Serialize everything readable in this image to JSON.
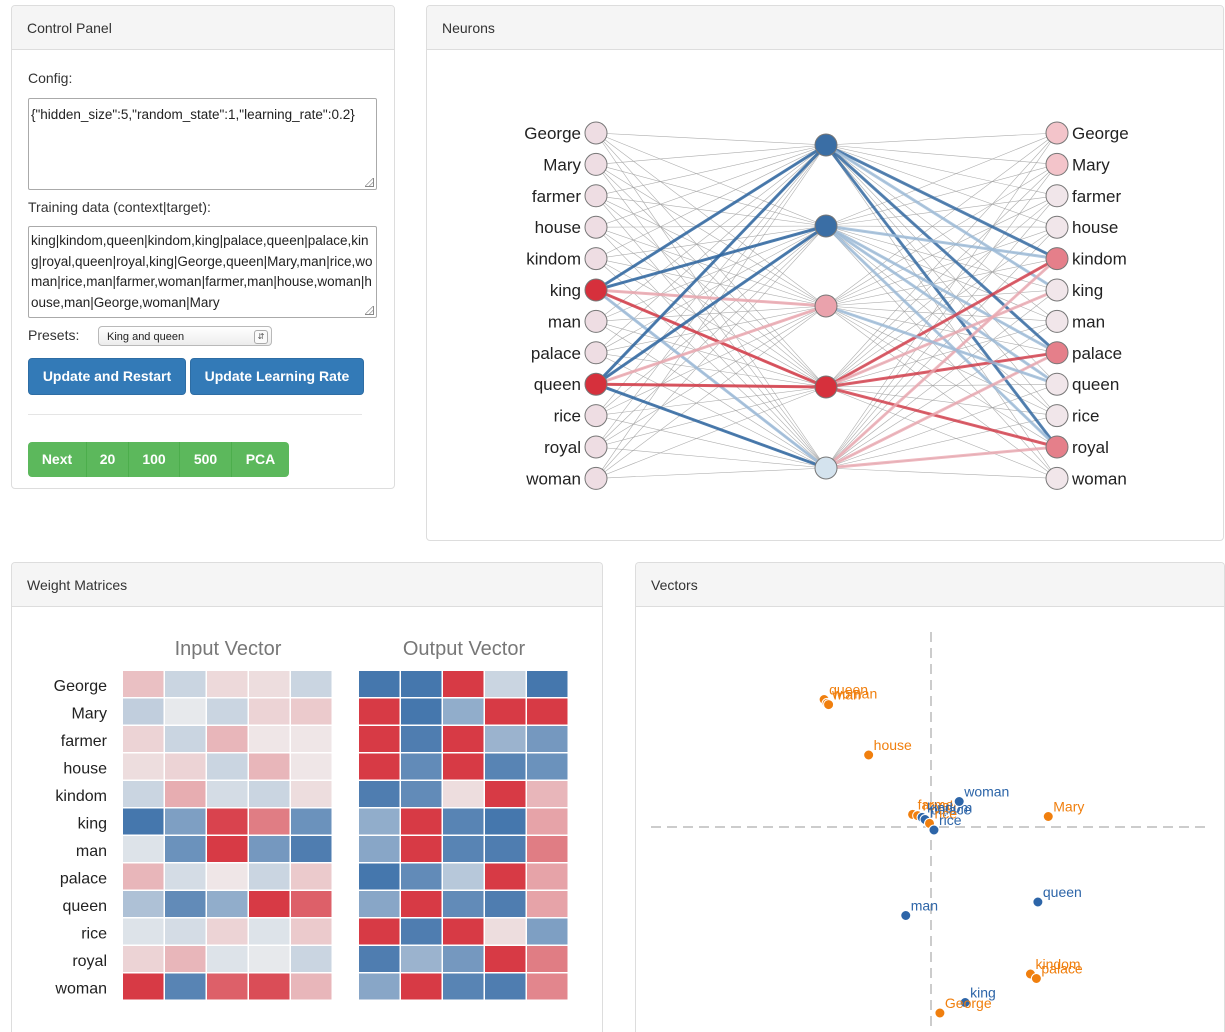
{
  "control_panel": {
    "title": "Control Panel",
    "config_label": "Config:",
    "config_value": "{\"hidden_size\":5,\"random_state\":1,\"learning_rate\":0.2}",
    "training_label": "Training data (context|target):",
    "training_value": "king|kindom,queen|kindom,king|palace,queen|palace,king|royal,queen|royal,king|George,queen|Mary,man|rice,woman|rice,man|farmer,woman|farmer,man|house,woman|house,man|George,woman|Mary",
    "presets_label": "Presets:",
    "preset_selected": "King and queen",
    "update_restart_label": "Update and Restart",
    "update_lr_label": "Update Learning Rate",
    "step_buttons": [
      "Next",
      "20",
      "100",
      "500",
      "PCA"
    ]
  },
  "neurons": {
    "title": "Neurons",
    "words": [
      "George",
      "Mary",
      "farmer",
      "house",
      "kindom",
      "king",
      "man",
      "palace",
      "queen",
      "rice",
      "royal",
      "woman"
    ],
    "input_colors": [
      "#eedde3",
      "#eedde3",
      "#eedde3",
      "#eedde3",
      "#eedde3",
      "#d6303c",
      "#eedde3",
      "#eedde3",
      "#d6303c",
      "#eedde3",
      "#eedde3",
      "#eedde3"
    ],
    "hidden_colors": [
      "#3a6ea5",
      "#3a6ea5",
      "#eaa2ac",
      "#d6303c",
      "#d4e3ee"
    ],
    "output_colors": [
      "#f3c4ca",
      "#f3c4ca",
      "#f1e6ea",
      "#f1e6ea",
      "#e57f8a",
      "#f1e6ea",
      "#f1e6ea",
      "#e57f8a",
      "#f1e6ea",
      "#f1e6ea",
      "#e57f8a",
      "#f1e6ea"
    ]
  },
  "weights": {
    "title": "Weight Matrices",
    "input_title": "Input Vector",
    "output_title": "Output Vector",
    "rows": [
      "George",
      "Mary",
      "farmer",
      "house",
      "kindom",
      "king",
      "man",
      "palace",
      "queen",
      "rice",
      "royal",
      "woman"
    ],
    "input_matrix": [
      [
        0.25,
        -0.2,
        0.12,
        0.1,
        -0.2
      ],
      [
        -0.25,
        -0.05,
        -0.2,
        0.15,
        0.2
      ],
      [
        0.15,
        -0.2,
        0.3,
        0.05,
        0.05
      ],
      [
        0.1,
        0.15,
        -0.2,
        0.3,
        0.05
      ],
      [
        -0.2,
        0.35,
        -0.15,
        -0.2,
        0.1
      ],
      [
        -0.9,
        -0.6,
        0.9,
        0.6,
        -0.7
      ],
      [
        -0.1,
        -0.7,
        0.95,
        -0.65,
        -0.85
      ],
      [
        0.3,
        -0.15,
        0.05,
        -0.2,
        0.2
      ],
      [
        -0.35,
        -0.75,
        -0.5,
        0.95,
        0.75
      ],
      [
        -0.1,
        -0.15,
        0.15,
        -0.1,
        0.2
      ],
      [
        0.15,
        0.3,
        -0.1,
        -0.05,
        -0.2
      ],
      [
        0.95,
        -0.8,
        0.75,
        0.85,
        0.3
      ]
    ],
    "output_matrix": [
      [
        -0.9,
        -0.9,
        0.95,
        -0.2,
        -0.9
      ],
      [
        0.95,
        -0.9,
        -0.5,
        0.95,
        0.95
      ],
      [
        0.95,
        -0.85,
        0.95,
        -0.45,
        -0.65
      ],
      [
        0.95,
        -0.75,
        0.95,
        -0.8,
        -0.7
      ],
      [
        -0.85,
        -0.75,
        0.1,
        0.95,
        0.3
      ],
      [
        -0.5,
        0.95,
        -0.8,
        -0.9,
        0.4
      ],
      [
        -0.55,
        0.95,
        -0.8,
        -0.85,
        0.6
      ],
      [
        -0.9,
        -0.75,
        -0.3,
        0.95,
        0.4
      ],
      [
        -0.55,
        0.95,
        -0.75,
        -0.85,
        0.4
      ],
      [
        0.95,
        -0.85,
        0.95,
        0.1,
        -0.6
      ],
      [
        -0.85,
        -0.45,
        -0.65,
        0.95,
        0.6
      ],
      [
        -0.55,
        0.95,
        -0.8,
        -0.85,
        0.55
      ]
    ]
  },
  "vectors": {
    "title": "Vectors",
    "input_color": "#f07f0e",
    "output_color": "#2d65a8",
    "points": [
      {
        "label": "queen",
        "kind": "input",
        "x": -3.6,
        "y": 4.25
      },
      {
        "label": "woman",
        "kind": "input",
        "x": -3.5,
        "y": 4.12
      },
      {
        "label": "man",
        "kind": "input",
        "x": -3.45,
        "y": 4.08
      },
      {
        "label": "house",
        "kind": "input",
        "x": -2.1,
        "y": 2.4
      },
      {
        "label": "farmer",
        "kind": "input",
        "x": -0.62,
        "y": 0.42
      },
      {
        "label": "royal",
        "kind": "input",
        "x": -0.45,
        "y": 0.38
      },
      {
        "label": "kindom",
        "kind": "output",
        "x": -0.3,
        "y": 0.32
      },
      {
        "label": "palace",
        "kind": "output",
        "x": -0.2,
        "y": 0.25
      },
      {
        "label": "rice",
        "kind": "input",
        "x": -0.05,
        "y": 0.12
      },
      {
        "label": "rice",
        "kind": "output",
        "x": 0.1,
        "y": -0.1
      },
      {
        "label": "woman",
        "kind": "output",
        "x": 0.95,
        "y": 0.85
      },
      {
        "label": "Mary",
        "kind": "input",
        "x": 3.95,
        "y": 0.35
      },
      {
        "label": "queen",
        "kind": "output",
        "x": 3.6,
        "y": -2.5
      },
      {
        "label": "man",
        "kind": "output",
        "x": -0.85,
        "y": -2.95
      },
      {
        "label": "kindom",
        "kind": "input",
        "x": 3.35,
        "y": -4.9
      },
      {
        "label": "palace",
        "kind": "input",
        "x": 3.55,
        "y": -5.05
      },
      {
        "label": "king",
        "kind": "output",
        "x": 1.15,
        "y": -5.85
      },
      {
        "label": "George",
        "kind": "input",
        "x": 0.3,
        "y": -6.2
      }
    ],
    "x_range": [
      -9.6,
      9.6
    ],
    "y_range": [
      -6.5,
      6.5
    ]
  }
}
